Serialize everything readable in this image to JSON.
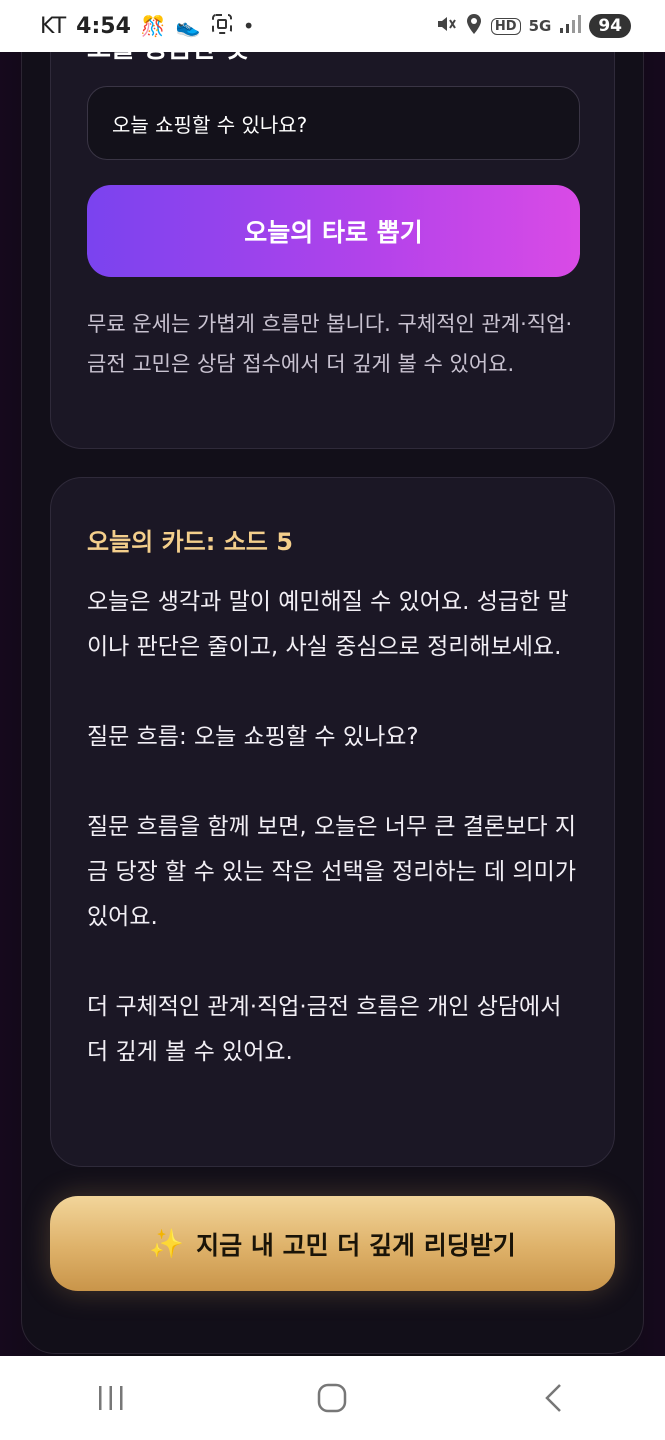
{
  "status_bar": {
    "carrier": "KT",
    "time": "4:54",
    "network": "5G",
    "hd": "HD",
    "battery": "94"
  },
  "question_section": {
    "title": "오늘 궁금한 것",
    "input_value": "오늘 쇼핑할 수 있나요?",
    "draw_button_label": "오늘의 타로 뽑기",
    "notice": "무료 운세는 가볍게 흐름만 봅니다. 구체적인 관계·직업·금전 고민은 상담 접수에서 더 깊게 볼 수 있어요."
  },
  "result_card": {
    "title": "오늘의 카드: 소드 5",
    "paragraphs": [
      "오늘은 생각과 말이 예민해질 수 있어요. 성급한 말이나 판단은 줄이고, 사실 중심으로 정리해보세요.",
      "질문 흐름: 오늘 쇼핑할 수 있나요?",
      "질문 흐름을 함께 보면, 오늘은 너무 큰 결론보다 지금 당장 할 수 있는 작은 선택을 정리하는 데 의미가 있어요.",
      "더 구체적인 관계·직업·금전 흐름은 개인 상담에서 더 깊게 볼 수 있어요."
    ]
  },
  "cta": {
    "icon": "✨",
    "label": "지금 내 고민 더 깊게 리딩받기"
  },
  "colors": {
    "accent_purple": "#7a43ef",
    "accent_pink": "#d94be6",
    "gold": "#deb169",
    "card_title_gold": "#f4cf8c"
  }
}
